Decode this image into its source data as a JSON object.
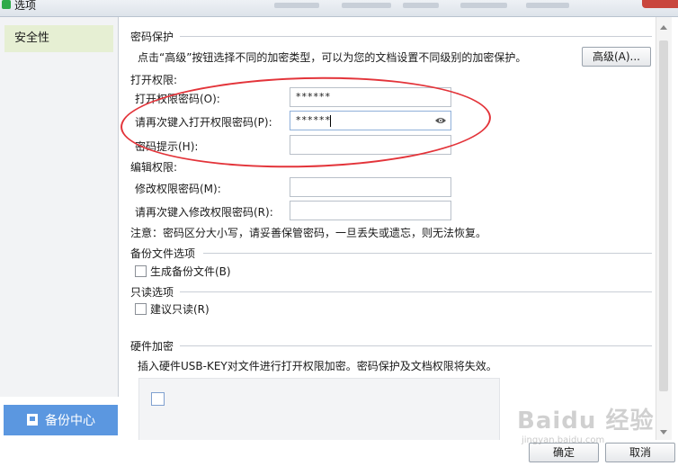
{
  "window": {
    "title": "选项"
  },
  "sidebar": {
    "items": [
      {
        "label": "安全性"
      }
    ],
    "backup_button": "备份中心"
  },
  "password": {
    "section_title": "密码保护",
    "advanced_desc": "点击“高级”按钮选择不同的加密类型，可以为您的文档设置不同级别的加密保护。",
    "advanced_button": "高级(A)...",
    "open_perm_title": "打开权限:",
    "open_pwd_label": "打开权限密码(O):",
    "open_pwd_value": "******",
    "open_pwd_confirm_label": "请再次键入打开权限密码(P):",
    "open_pwd_confirm_value": "******",
    "hint_label": "密码提示(H):",
    "hint_value": "",
    "edit_perm_title": "编辑权限:",
    "edit_pwd_label": "修改权限密码(M):",
    "edit_pwd_value": "",
    "edit_pwd_confirm_label": "请再次键入修改权限密码(R):",
    "edit_pwd_confirm_value": "",
    "note": "注意：密码区分大小写，请妥善保管密码，一旦丢失或遗忘，则无法恢复。"
  },
  "backup": {
    "section_title": "备份文件选项",
    "checkbox_label": "生成备份文件(B)"
  },
  "readonly": {
    "section_title": "只读选项",
    "checkbox_label": "建议只读(R)"
  },
  "hardware": {
    "section_title": "硬件加密",
    "desc": "插入硬件USB-KEY对文件进行打开权限加密。密码保护及文档权限将失效。"
  },
  "footer": {
    "ok_button": "确定",
    "cancel_button": "取消"
  },
  "watermark": {
    "text": "Baidu 经验",
    "sub": "jingyan.baidu.com"
  },
  "colors": {
    "sidebar_selected": "#e6efd3",
    "backup_button": "#5b97e0",
    "annotation": "#e3343a"
  }
}
